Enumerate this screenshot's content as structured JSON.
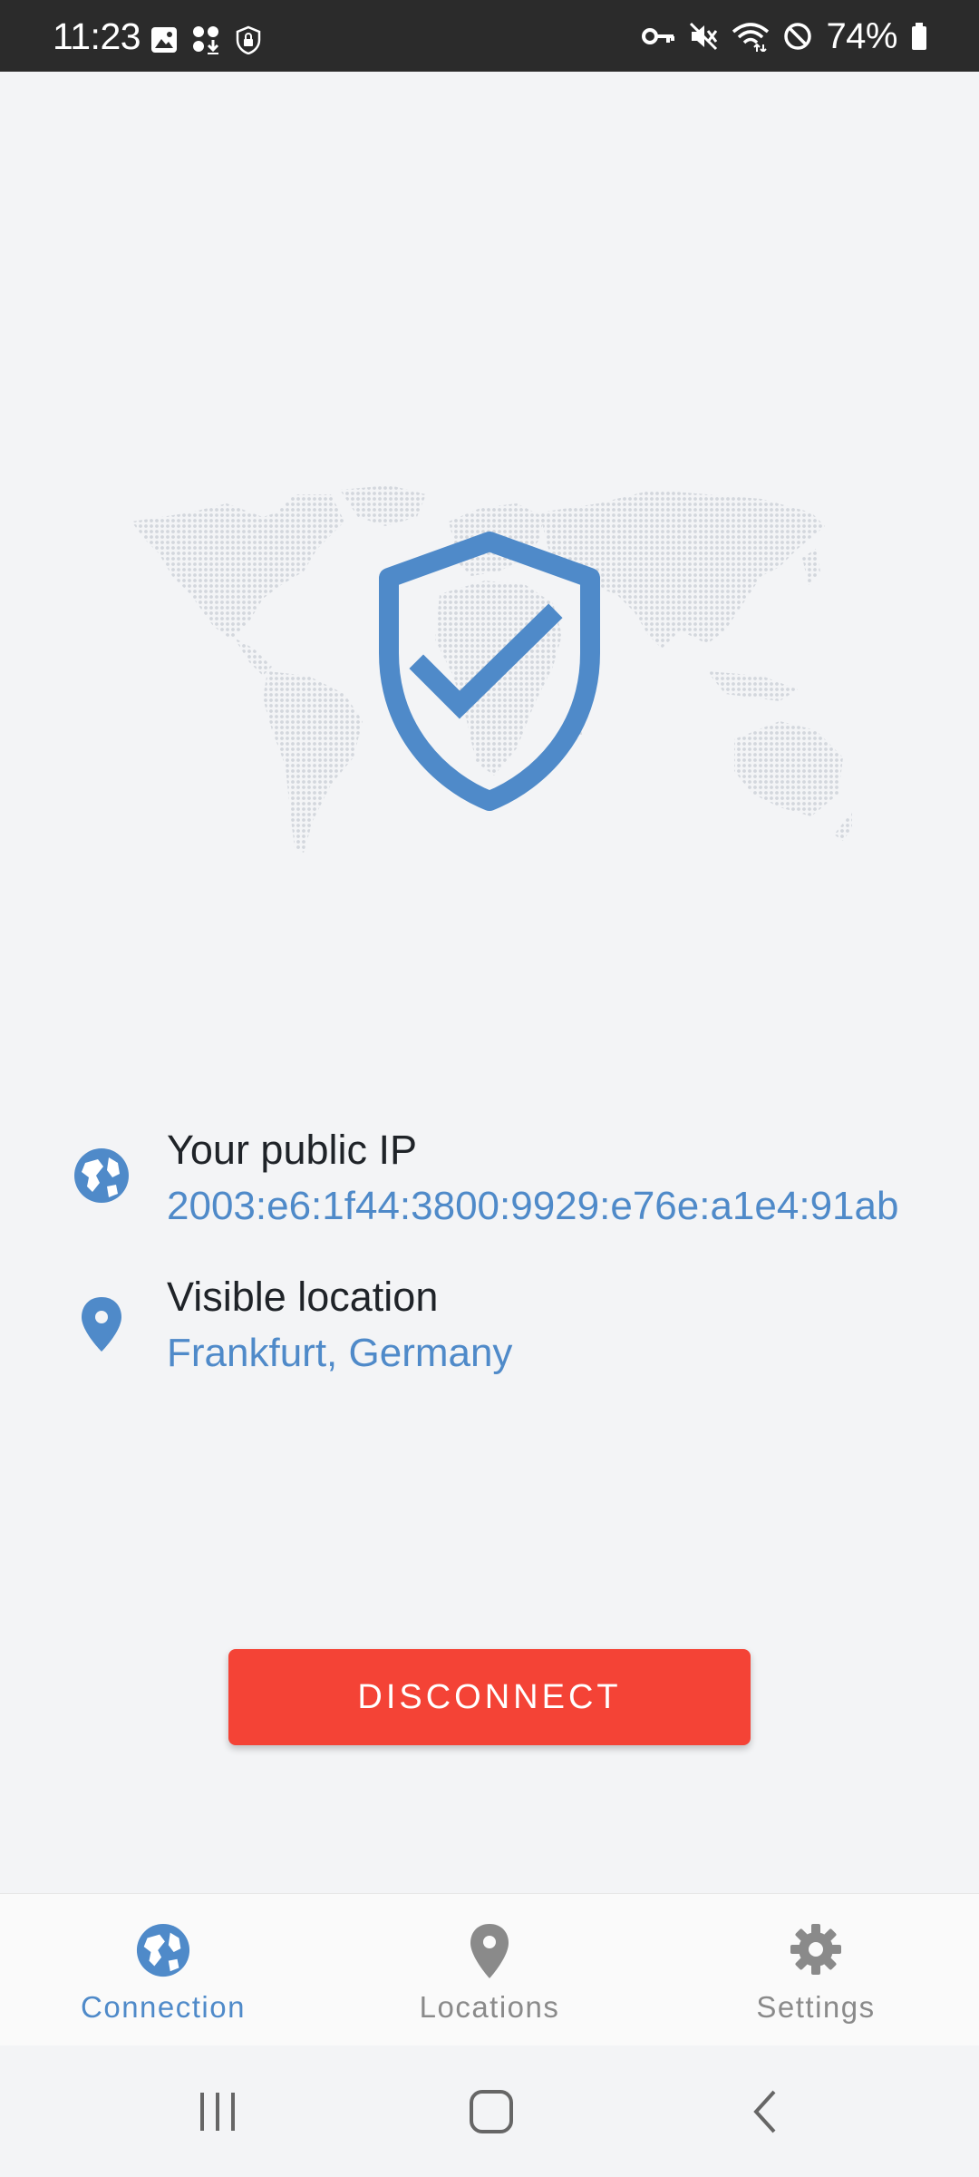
{
  "status_bar": {
    "time": "11:23",
    "battery_percent": "74%",
    "left_icons": [
      "image-icon",
      "download-icon",
      "shield-lock-icon"
    ],
    "right_icons": [
      "vpn-key-icon",
      "mute-icon",
      "wifi-icon",
      "dnd-icon",
      "battery-icon"
    ]
  },
  "hero": {
    "icon": "shield-check-icon",
    "background": "world-map"
  },
  "connection_info": {
    "public_ip": {
      "label": "Your public IP",
      "value": "2003:e6:1f44:3800:9929:e76e:a1e4:91ab",
      "icon": "globe-icon"
    },
    "visible_location": {
      "label": "Visible location",
      "value": "Frankfurt, Germany",
      "icon": "location-pin-icon"
    }
  },
  "actions": {
    "disconnect_label": "DISCONNECT"
  },
  "tabs": [
    {
      "label": "Connection",
      "icon": "globe-icon",
      "active": true
    },
    {
      "label": "Locations",
      "icon": "location-pin-icon",
      "active": false
    },
    {
      "label": "Settings",
      "icon": "gear-icon",
      "active": false
    }
  ],
  "nav_bar": [
    "recents-icon",
    "home-icon",
    "back-icon"
  ],
  "colors": {
    "accent": "#4f8ac9",
    "disconnect": "#f44336",
    "background": "#f3f4f6",
    "map_dots": "#d3d7dd"
  }
}
